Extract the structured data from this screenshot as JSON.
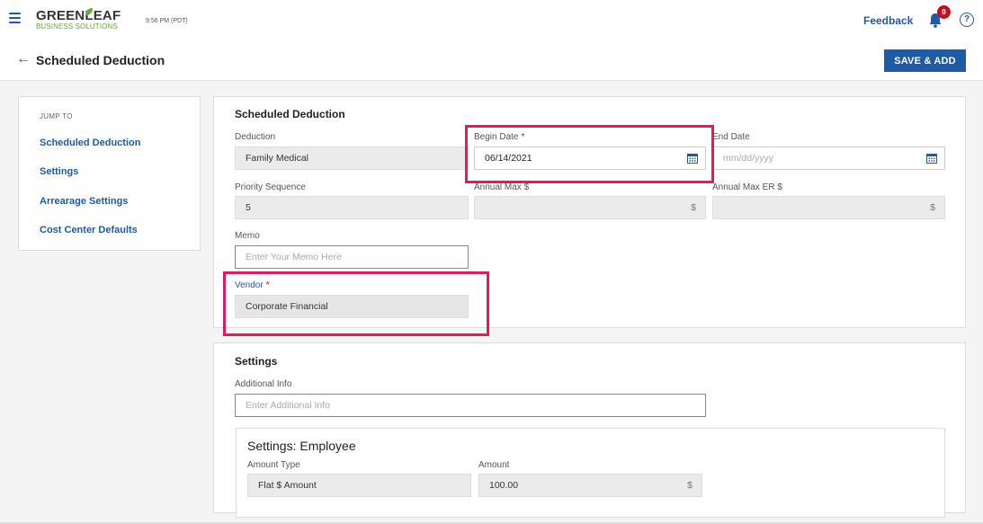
{
  "header": {
    "logo_top": "GREENLEAF",
    "logo_bottom": "BUSINESS SOLUTIONS",
    "time": "9:56 PM (PDT)",
    "feedback": "Feedback",
    "notification_count": "0",
    "help_symbol": "?"
  },
  "page": {
    "back_symbol": "←",
    "title": "Scheduled Deduction",
    "save_label": "SAVE & ADD"
  },
  "jump_to": {
    "title": "JUMP TO",
    "items": [
      {
        "label": "Scheduled Deduction"
      },
      {
        "label": "Settings"
      },
      {
        "label": "Arrearage Settings"
      },
      {
        "label": "Cost Center Defaults"
      }
    ]
  },
  "scheduled_deduction": {
    "title": "Scheduled Deduction",
    "deduction_label": "Deduction",
    "deduction_value": "Family Medical",
    "begin_date_label": "Begin Date",
    "begin_date_value": "06/14/2021",
    "end_date_label": "End Date",
    "end_date_placeholder": "mm/dd/yyyy",
    "priority_label": "Priority Sequence",
    "priority_value": "5",
    "annual_max_label": "Annual Max $",
    "annual_max_er_label": "Annual Max ER $",
    "currency_symbol": "$",
    "memo_label": "Memo",
    "memo_placeholder": "Enter Your Memo Here",
    "vendor_label": "Vendor",
    "vendor_value": "Corporate Financial",
    "required_mark": "*"
  },
  "settings": {
    "title": "Settings",
    "additional_info_label": "Additional Info",
    "additional_info_placeholder": "Enter Additional Info",
    "employee_title": "Settings: Employee",
    "amount_type_label": "Amount Type",
    "amount_type_value": "Flat $ Amount",
    "amount_label": "Amount",
    "amount_value": "100.00",
    "currency_symbol": "$"
  },
  "colors": {
    "primary": "#1f5aa6",
    "highlight": "#e8185f",
    "badge": "#c0101a",
    "logo_green": "#6aa83a"
  },
  "icons": [
    "hamburger-icon",
    "leaf-icon",
    "bell-icon",
    "help-icon",
    "back-arrow-icon",
    "calendar-icon"
  ]
}
